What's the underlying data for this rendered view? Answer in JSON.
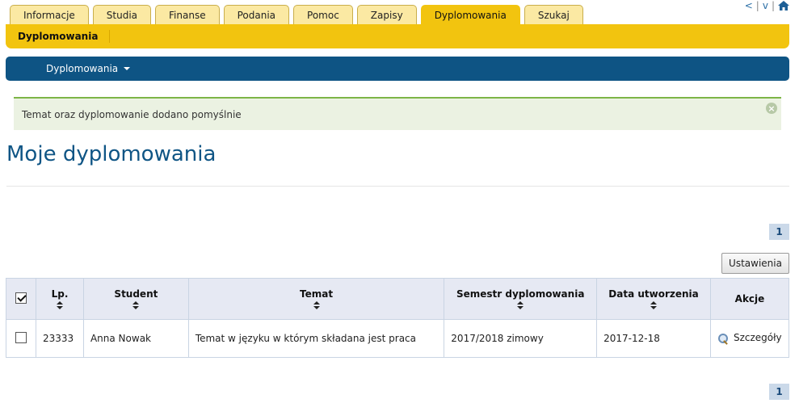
{
  "topnav": {
    "prev": "<",
    "sep1": "|",
    "down": "v",
    "sep2": "|",
    "home_icon": "home-icon"
  },
  "tabs": [
    {
      "label": "Informacje",
      "active": false
    },
    {
      "label": "Studia",
      "active": false
    },
    {
      "label": "Finanse",
      "active": false
    },
    {
      "label": "Podania",
      "active": false
    },
    {
      "label": "Pomoc",
      "active": false
    },
    {
      "label": "Zapisy",
      "active": false
    },
    {
      "label": "Dyplomowania",
      "active": true
    },
    {
      "label": "Szukaj",
      "active": false
    }
  ],
  "subbar": {
    "item": "Dyplomowania"
  },
  "menubar": {
    "dropdown": "Dyplomowania"
  },
  "alert": {
    "message": "Temat oraz dyplomowanie dodano pomyślnie",
    "close": "×"
  },
  "page": {
    "title": "Moje dyplomowania"
  },
  "pager": {
    "top": "1",
    "bottom": "1"
  },
  "toolbar": {
    "settings_label": "Ustawienia"
  },
  "table": {
    "headers": {
      "lp": "Lp.",
      "student": "Student",
      "temat": "Temat",
      "semestr": "Semestr dyplomowania",
      "data": "Data utworzenia",
      "akcje": "Akcje"
    },
    "rows": [
      {
        "lp": "23333",
        "student": "Anna Nowak",
        "temat": "Temat w języku w którym składana jest praca",
        "semestr": "2017/2018 zimowy",
        "data": "2017-12-18",
        "action": "Szczegóły"
      }
    ]
  },
  "colors": {
    "yellow": "#f2c40f",
    "tab_inactive": "#fbe9a3",
    "blue_bar": "#0e5484",
    "title_blue": "#0f5585",
    "alert_bg": "#ebf2e2",
    "alert_border": "#7db547"
  }
}
